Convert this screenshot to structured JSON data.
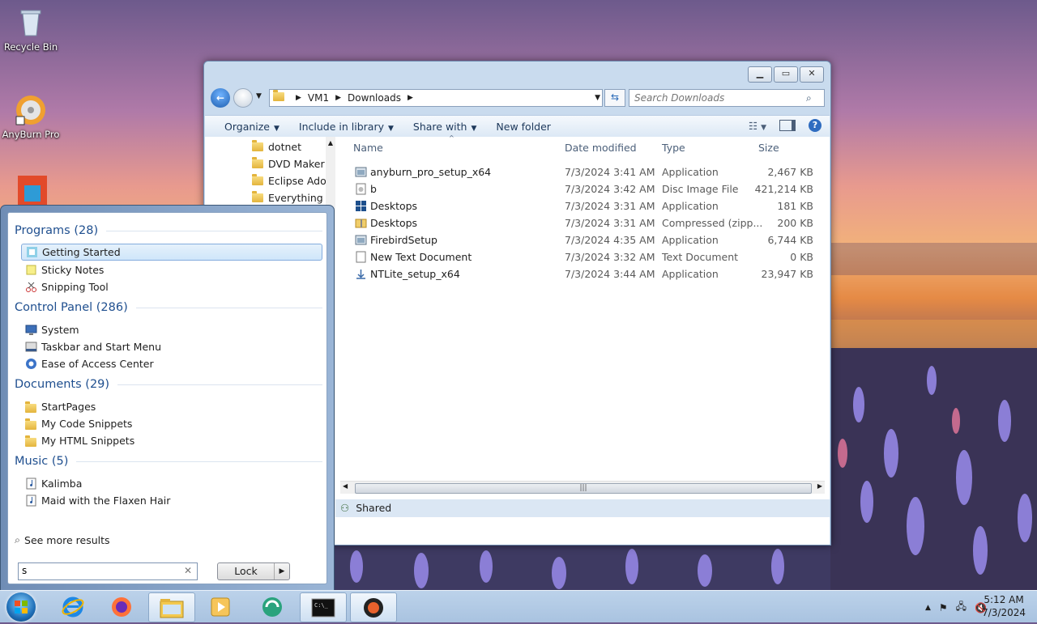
{
  "desktop": {
    "icons": [
      {
        "label": "Recycle Bin"
      },
      {
        "label": "AnyBurn Pro"
      }
    ]
  },
  "explorer": {
    "breadcrumb": [
      "VM1",
      "Downloads"
    ],
    "search_placeholder": "Search Downloads",
    "toolbar": {
      "organize": "Organize",
      "include": "Include in library",
      "share": "Share with",
      "new_folder": "New folder"
    },
    "nav_items": [
      "dotnet",
      "DVD Maker",
      "Eclipse Adopt",
      "Everything"
    ],
    "columns": {
      "name": "Name",
      "date": "Date modified",
      "type": "Type",
      "size": "Size"
    },
    "files": [
      {
        "name": "anyburn_pro_setup_x64",
        "date": "7/3/2024 3:41 AM",
        "type": "Application",
        "size": "2,467 KB",
        "icon": "installer-icon"
      },
      {
        "name": "b",
        "date": "7/3/2024 3:42 AM",
        "type": "Disc Image File",
        "size": "421,214 KB",
        "icon": "disc-image-icon"
      },
      {
        "name": "Desktops",
        "date": "7/3/2024 3:31 AM",
        "type": "Application",
        "size": "181 KB",
        "icon": "desktops-app-icon"
      },
      {
        "name": "Desktops",
        "date": "7/3/2024 3:31 AM",
        "type": "Compressed (zipp...",
        "size": "200 KB",
        "icon": "zip-folder-icon"
      },
      {
        "name": "FirebirdSetup",
        "date": "7/3/2024 4:35 AM",
        "type": "Application",
        "size": "6,744 KB",
        "icon": "installer-icon"
      },
      {
        "name": "New Text Document",
        "date": "7/3/2024 3:32 AM",
        "type": "Text Document",
        "size": "0 KB",
        "icon": "text-document-icon"
      },
      {
        "name": "NTLite_setup_x64",
        "date": "7/3/2024 3:44 AM",
        "type": "Application",
        "size": "23,947 KB",
        "icon": "ntlite-icon"
      }
    ],
    "status": "Shared"
  },
  "start_menu": {
    "groups": [
      {
        "title": "Programs (28)",
        "items": [
          "Getting Started",
          "Sticky Notes",
          "Snipping Tool"
        ]
      },
      {
        "title": "Control Panel (286)",
        "items": [
          "System",
          "Taskbar and Start Menu",
          "Ease of Access Center"
        ]
      },
      {
        "title": "Documents (29)",
        "items": [
          "StartPages",
          "My Code Snippets",
          "My HTML Snippets"
        ]
      },
      {
        "title": "Music (5)",
        "items": [
          "Kalimba",
          "Maid with the Flaxen Hair"
        ]
      }
    ],
    "see_more": "See more results",
    "search_value": "s",
    "lock_label": "Lock"
  },
  "taskbar": {
    "time": "5:12 AM",
    "date": "7/3/2024"
  },
  "colors": {
    "accent": "#1f4f8f",
    "selection": "#cfe6fa"
  }
}
